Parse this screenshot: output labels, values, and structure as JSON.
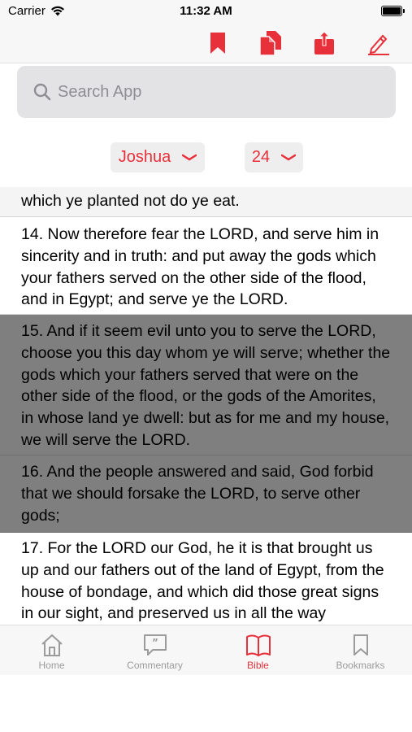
{
  "status_bar": {
    "carrier": "Carrier",
    "time": "11:32 AM"
  },
  "toolbar": {
    "icons": [
      "bookmark-icon",
      "copy-icon",
      "share-icon",
      "edit-icon"
    ],
    "accent_color": "#e8303a"
  },
  "search": {
    "placeholder": "Search App"
  },
  "pickers": {
    "book": "Joshua",
    "chapter": "24"
  },
  "verses": [
    {
      "text": "which ye planted not do ye eat.",
      "selected": false
    },
    {
      "text": "14. Now therefore fear the LORD, and serve him in sincerity and in truth: and put away the gods which your fathers served on the other side of the flood, and in Egypt; and serve ye the LORD.",
      "selected": false
    },
    {
      "text": "15. And if it seem evil unto you to serve the LORD, choose you this day whom ye will serve; whether the gods which your fathers served that were on the other side of the flood, or the gods of the Amorites, in whose land ye dwell: but as for me and my house, we will serve the LORD.",
      "selected": true
    },
    {
      "text": "16. And the people answered and said, God forbid that we should forsake the LORD, to serve other gods;",
      "selected": true
    },
    {
      "text": "17. For the LORD our God, he it is that brought us up and our fathers out of the land of Egypt, from the house of bondage, and which did those great signs in our sight, and preserved us in all the way",
      "selected": false
    }
  ],
  "tabs": [
    {
      "label": "Home",
      "icon": "home-icon",
      "active": false
    },
    {
      "label": "Commentary",
      "icon": "commentary-icon",
      "active": false
    },
    {
      "label": "Bible",
      "icon": "bible-icon",
      "active": true
    },
    {
      "label": "Bookmarks",
      "icon": "bookmarks-icon",
      "active": false
    }
  ]
}
